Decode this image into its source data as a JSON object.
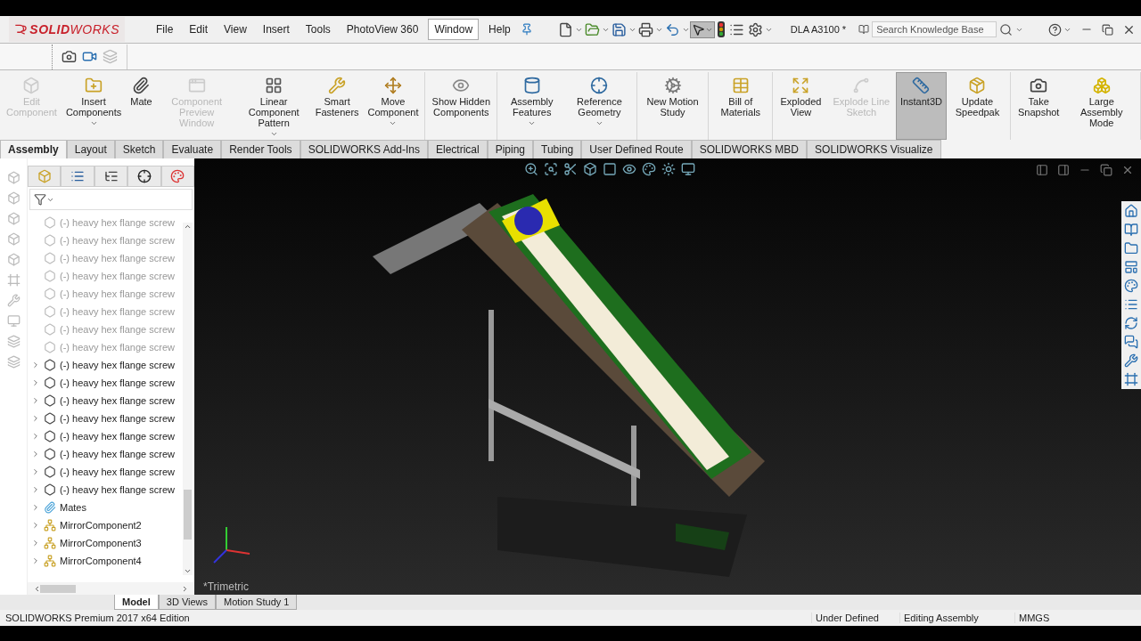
{
  "app": {
    "logo": "**SOLID**WORKS",
    "title": "DLA A3100 *"
  },
  "menu": [
    {
      "label": "File",
      "selected": false
    },
    {
      "label": "Edit",
      "selected": false
    },
    {
      "label": "View",
      "selected": false
    },
    {
      "label": "Insert",
      "selected": false
    },
    {
      "label": "Tools",
      "selected": false
    },
    {
      "label": "PhotoView 360",
      "selected": false
    },
    {
      "label": "Window",
      "selected": true
    },
    {
      "label": "Help",
      "selected": false
    }
  ],
  "search": {
    "placeholder": "Search Knowledge Base"
  },
  "ribbon": {
    "groups": [
      [
        {
          "label": "Edit Component",
          "disabled": true,
          "has_menu": false,
          "selected": false
        },
        {
          "label": "Insert Components",
          "disabled": false,
          "has_menu": true,
          "selected": false
        },
        {
          "label": "Mate",
          "disabled": false,
          "has_menu": false,
          "selected": false
        },
        {
          "label": "Component Preview Window",
          "disabled": true,
          "has_menu": false,
          "selected": false
        },
        {
          "label": "Linear Component Pattern",
          "disabled": false,
          "has_menu": true,
          "selected": false
        },
        {
          "label": "Smart Fasteners",
          "disabled": false,
          "has_menu": false,
          "selected": false
        },
        {
          "label": "Move Component",
          "disabled": false,
          "has_menu": true,
          "selected": false
        }
      ],
      [
        {
          "label": "Show Hidden Components",
          "disabled": false,
          "has_menu": false,
          "selected": false
        }
      ],
      [
        {
          "label": "Assembly Features",
          "disabled": false,
          "has_menu": true,
          "selected": false
        },
        {
          "label": "Reference Geometry",
          "disabled": false,
          "has_menu": true,
          "selected": false
        }
      ],
      [
        {
          "label": "New Motion Study",
          "disabled": false,
          "has_menu": false,
          "selected": false
        }
      ],
      [
        {
          "label": "Bill of Materials",
          "disabled": false,
          "has_menu": false,
          "selected": false
        }
      ],
      [
        {
          "label": "Exploded View",
          "disabled": false,
          "has_menu": false,
          "selected": false
        },
        {
          "label": "Explode Line Sketch",
          "disabled": true,
          "has_menu": false,
          "selected": false
        },
        {
          "label": "Instant3D",
          "disabled": false,
          "has_menu": false,
          "selected": true
        },
        {
          "label": "Update Speedpak",
          "disabled": false,
          "has_menu": false,
          "selected": false
        }
      ],
      [
        {
          "label": "Take Snapshot",
          "disabled": false,
          "has_menu": false,
          "selected": false
        },
        {
          "label": "Large Assembly Mode",
          "disabled": false,
          "has_menu": false,
          "selected": false
        }
      ]
    ]
  },
  "tabs": [
    {
      "label": "Assembly",
      "selected": true
    },
    {
      "label": "Layout",
      "selected": false
    },
    {
      "label": "Sketch",
      "selected": false
    },
    {
      "label": "Evaluate",
      "selected": false
    },
    {
      "label": "Render Tools",
      "selected": false
    },
    {
      "label": "SOLIDWORKS Add-Ins",
      "selected": false
    },
    {
      "label": "Electrical",
      "selected": false
    },
    {
      "label": "Piping",
      "selected": false
    },
    {
      "label": "Tubing",
      "selected": false
    },
    {
      "label": "User Defined Route",
      "selected": false
    },
    {
      "label": "SOLIDWORKS MBD",
      "selected": false
    },
    {
      "label": "SOLIDWORKS Visualize",
      "selected": false
    }
  ],
  "tree": [
    {
      "kind": "part",
      "label": "(-) heavy hex flange screw",
      "suppressed": true,
      "expandable": false
    },
    {
      "kind": "part",
      "label": "(-) heavy hex flange screw",
      "suppressed": true,
      "expandable": false
    },
    {
      "kind": "part",
      "label": "(-) heavy hex flange screw",
      "suppressed": true,
      "expandable": false
    },
    {
      "kind": "part",
      "label": "(-) heavy hex flange screw",
      "suppressed": true,
      "expandable": false
    },
    {
      "kind": "part",
      "label": "(-) heavy hex flange screw",
      "suppressed": true,
      "expandable": false
    },
    {
      "kind": "part",
      "label": "(-) heavy hex flange screw",
      "suppressed": true,
      "expandable": false
    },
    {
      "kind": "part",
      "label": "(-) heavy hex flange screw",
      "suppressed": true,
      "expandable": false
    },
    {
      "kind": "part",
      "label": "(-) heavy hex flange screw",
      "suppressed": true,
      "expandable": false
    },
    {
      "kind": "part",
      "label": "(-) heavy hex flange screw",
      "suppressed": false,
      "expandable": true
    },
    {
      "kind": "part",
      "label": "(-) heavy hex flange screw",
      "suppressed": false,
      "expandable": true
    },
    {
      "kind": "part",
      "label": "(-) heavy hex flange screw",
      "suppressed": false,
      "expandable": true
    },
    {
      "kind": "part",
      "label": "(-) heavy hex flange screw",
      "suppressed": false,
      "expandable": true
    },
    {
      "kind": "part",
      "label": "(-) heavy hex flange screw",
      "suppressed": false,
      "expandable": true
    },
    {
      "kind": "part",
      "label": "(-) heavy hex flange screw",
      "suppressed": false,
      "expandable": true
    },
    {
      "kind": "part",
      "label": "(-) heavy hex flange screw",
      "suppressed": false,
      "expandable": true
    },
    {
      "kind": "part",
      "label": "(-) heavy hex flange screw",
      "suppressed": false,
      "expandable": true
    },
    {
      "kind": "mates",
      "label": "Mates",
      "suppressed": false,
      "expandable": true
    },
    {
      "kind": "mirror",
      "label": "MirrorComponent2",
      "suppressed": false,
      "expandable": true
    },
    {
      "kind": "mirror",
      "label": "MirrorComponent3",
      "suppressed": false,
      "expandable": true
    },
    {
      "kind": "mirror",
      "label": "MirrorComponent4",
      "suppressed": false,
      "expandable": true
    }
  ],
  "viewport": {
    "view_label": "*Trimetric",
    "kind": "picture"
  },
  "bottom_tabs": [
    {
      "label": "Model",
      "selected": true
    },
    {
      "label": "3D Views",
      "selected": false
    },
    {
      "label": "Motion Study 1",
      "selected": false
    }
  ],
  "status_bar": {
    "edition": "SOLIDWORKS Premium 2017 x64 Edition",
    "definition": "Under Defined",
    "mode": "Editing Assembly",
    "units": "MMGS"
  }
}
